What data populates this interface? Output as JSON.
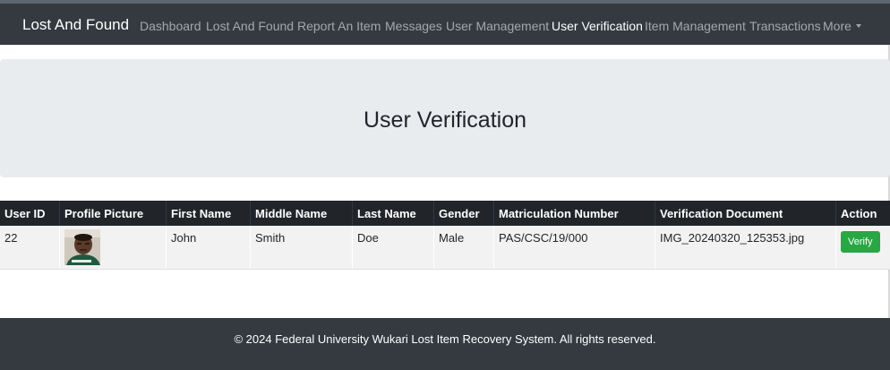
{
  "navbar": {
    "brand": "Lost And Found",
    "links": [
      {
        "label": "Dashboard",
        "active": false
      },
      {
        "label": "Lost And Found",
        "active": false
      },
      {
        "label": "Report An Item",
        "active": false
      },
      {
        "label": "Messages",
        "active": false
      },
      {
        "label": "User Management",
        "active": false
      },
      {
        "label": "User Verification",
        "active": true
      },
      {
        "label": "Item Management",
        "active": false
      },
      {
        "label": "Transactions",
        "active": false
      },
      {
        "label": "More",
        "active": false
      }
    ]
  },
  "header": {
    "title": "User Verification"
  },
  "table": {
    "columns": [
      "User ID",
      "Profile Picture",
      "First Name",
      "Middle Name",
      "Last Name",
      "Gender",
      "Matriculation Number",
      "Verification Document",
      "Action"
    ],
    "rows": [
      {
        "user_id": "22",
        "first_name": "John",
        "middle_name": "Smith",
        "last_name": "Doe",
        "gender": "Male",
        "matriculation_number": "PAS/CSC/19/000",
        "verification_document": "IMG_20240320_125353.jpg",
        "action_label": "Verify"
      }
    ]
  },
  "footer": {
    "text": "© 2024 Federal University Wukari Lost Item Recovery System. All rights reserved."
  },
  "colors": {
    "navbar": "#343a40",
    "table_header": "#212529",
    "verify_button": "#28a745",
    "jumbotron": "#e9ecef"
  }
}
